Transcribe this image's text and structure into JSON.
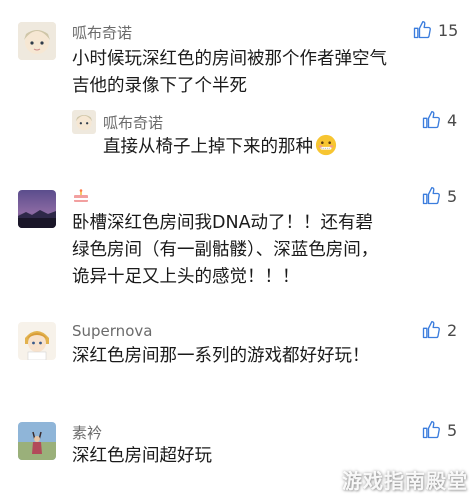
{
  "comments": [
    {
      "user": "呱布奇诺",
      "text": "小时候玩深红色的房间被那个作者弹空气吉他的录像下了个半死",
      "likes": "15"
    },
    {
      "user": "呱布奇诺",
      "text": "直接从椅子上掉下来的那种",
      "likes": "4",
      "emoji": "zipper-mouth-face"
    },
    {
      "user": "",
      "text": "卧槽深红色房间我DNA动了！！还有碧绿色房间（有一副骷髅）、深蓝色房间，诡异十足又上头的感觉！！！",
      "likes": "5"
    },
    {
      "user": "Supernova",
      "text": "深红色房间那一系列的游戏都好好玩！",
      "likes": "2"
    },
    {
      "user": "素衿",
      "text": "深红色房间超好玩",
      "likes": "5"
    }
  ],
  "watermark": "游戏指南殿堂",
  "colors": {
    "accent": "#3b7ddd",
    "name": "#6b6b6b",
    "text": "#1a1a1a"
  }
}
